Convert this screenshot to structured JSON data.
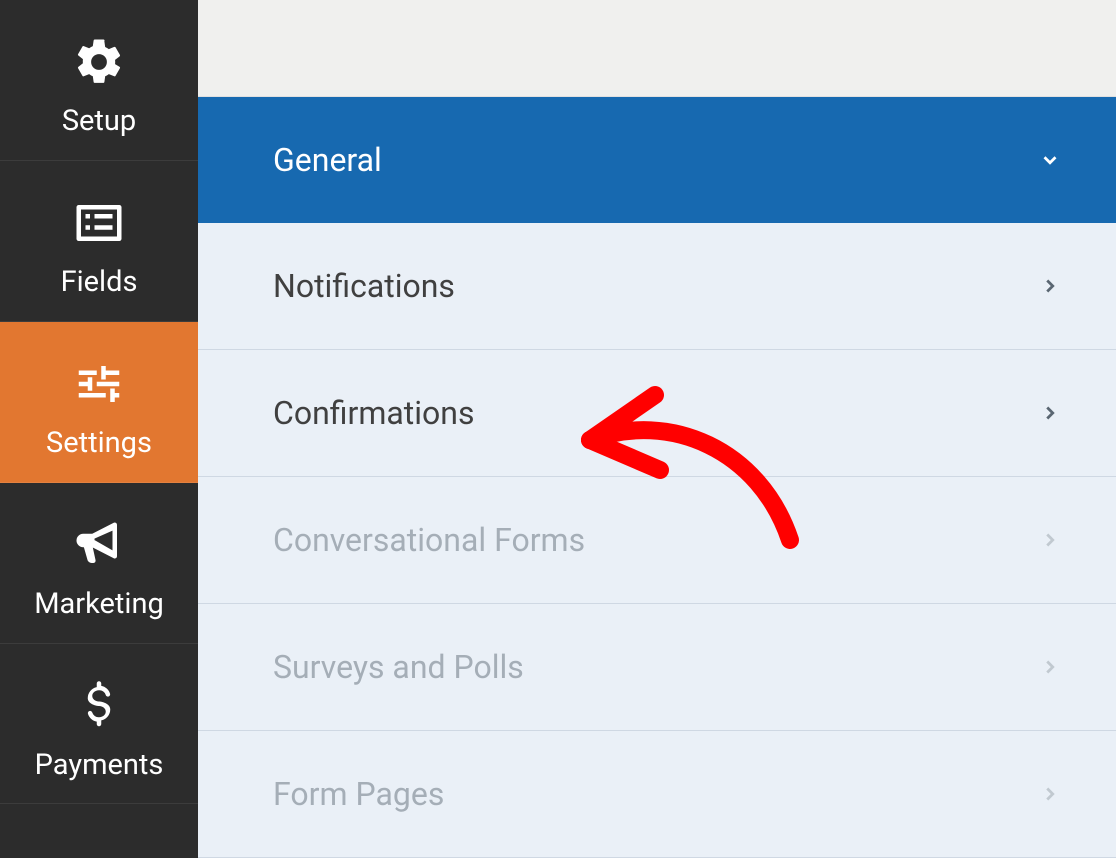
{
  "sidebar": {
    "items": [
      {
        "label": "Setup",
        "icon": "gear-icon",
        "active": false
      },
      {
        "label": "Fields",
        "icon": "list-icon",
        "active": false
      },
      {
        "label": "Settings",
        "icon": "sliders-icon",
        "active": true
      },
      {
        "label": "Marketing",
        "icon": "bullhorn-icon",
        "active": false
      },
      {
        "label": "Payments",
        "icon": "dollar-icon",
        "active": false
      }
    ]
  },
  "panel": {
    "items": [
      {
        "label": "General",
        "state": "active"
      },
      {
        "label": "Notifications",
        "state": "enabled"
      },
      {
        "label": "Confirmations",
        "state": "enabled"
      },
      {
        "label": "Conversational Forms",
        "state": "disabled"
      },
      {
        "label": "Surveys and Polls",
        "state": "disabled"
      },
      {
        "label": "Form Pages",
        "state": "disabled"
      }
    ]
  }
}
